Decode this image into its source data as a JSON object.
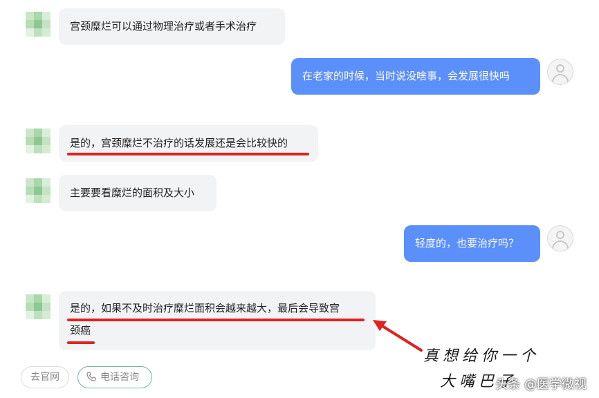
{
  "messages": [
    {
      "role": "doctor",
      "text": "宫颈糜烂可以通过物理治疗或者手术治疗"
    },
    {
      "role": "user",
      "text": "在老家的时候，当时说没啥事，会发展很快吗"
    },
    {
      "role": "doctor",
      "text": "是的，宫颈糜烂不治疗的话发展还是会比较快的"
    },
    {
      "role": "doctor",
      "text": "主要要看糜烂的面积及大小"
    },
    {
      "role": "user",
      "text": "轻度的，也要治疗吗？"
    },
    {
      "role": "doctor",
      "text_line1": "是的，如果不及时治疗糜烂面积会越来越大，最后会导致宫",
      "text_line2": "颈癌"
    }
  ],
  "bottom_bar": {
    "official_site": "去官网",
    "phone_consult": "电话咨询"
  },
  "annotation": {
    "line1": "真想给你一个",
    "line2": "大嘴巴子"
  },
  "watermark": "头条 @医学微视",
  "colors": {
    "user_bubble": "#5b8ff9",
    "doctor_bubble": "#f2f3f5",
    "highlight": "#e0211f"
  }
}
